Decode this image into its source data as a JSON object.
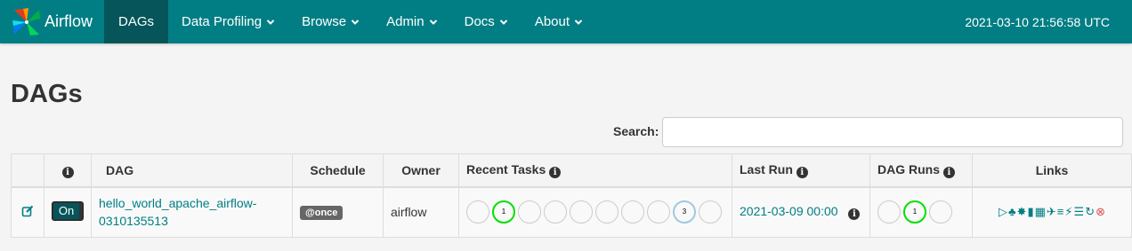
{
  "brand": {
    "name": "Airflow"
  },
  "nav": {
    "items": [
      {
        "label": "DAGs",
        "active": true,
        "dropdown": false
      },
      {
        "label": "Data Profiling",
        "active": false,
        "dropdown": true
      },
      {
        "label": "Browse",
        "active": false,
        "dropdown": true
      },
      {
        "label": "Admin",
        "active": false,
        "dropdown": true
      },
      {
        "label": "Docs",
        "active": false,
        "dropdown": true
      },
      {
        "label": "About",
        "active": false,
        "dropdown": true
      }
    ],
    "time": "2021-03-10 21:56:58 UTC"
  },
  "page": {
    "title": "DAGs"
  },
  "search": {
    "label": "Search:",
    "value": ""
  },
  "table": {
    "headers": {
      "dag": "DAG",
      "schedule": "Schedule",
      "owner": "Owner",
      "recent_tasks": "Recent Tasks",
      "last_run": "Last Run",
      "dag_runs": "DAG Runs",
      "links": "Links"
    },
    "rows": [
      {
        "toggle": "On",
        "dag_id_line1": "hello_world_apache_airflow-",
        "dag_id_line2": "0310135513",
        "schedule": "@once",
        "owner": "airflow",
        "recent_tasks": [
          "",
          "1",
          "",
          "",
          "",
          "",
          "",
          "",
          "3",
          ""
        ],
        "last_run": "2021-03-09 00:00",
        "dag_runs": [
          "",
          "1",
          ""
        ],
        "links": [
          "trigger-dag-icon",
          "tree-view-icon",
          "graph-view-icon",
          "task-duration-icon",
          "task-tries-icon",
          "landing-times-icon",
          "gantt-icon",
          "code-view-icon",
          "logs-icon",
          "refresh-icon",
          "delete-icon"
        ]
      }
    ]
  },
  "colors": {
    "navbar": "#017e84",
    "navbar_active": "#05555a",
    "link": "#017e84",
    "success": "#00e000",
    "upstream_failed": "#a0c8e0",
    "danger": "#d9534f"
  }
}
